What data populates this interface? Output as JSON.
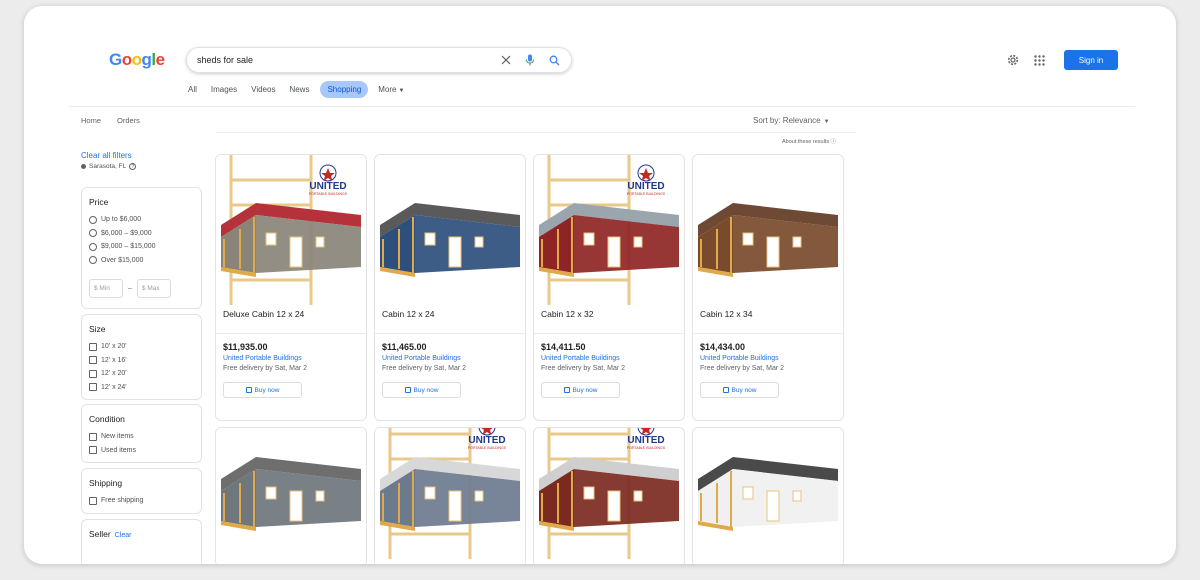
{
  "header": {
    "logo": [
      "G",
      "o",
      "o",
      "g",
      "l",
      "e"
    ],
    "logo_colors": [
      "#4285f4",
      "#ea4335",
      "#fbbc05",
      "#4285f4",
      "#34a853",
      "#ea4335"
    ],
    "search_value": "sheds for sale",
    "signin_label": "Sign in"
  },
  "tabs": [
    {
      "label": "All"
    },
    {
      "label": "Images"
    },
    {
      "label": "Videos"
    },
    {
      "label": "News"
    },
    {
      "label": "Shopping",
      "active": true
    },
    {
      "label": "More"
    }
  ],
  "subnav": {
    "home": "Home",
    "orders": "Orders",
    "sort": "Sort by: Relevance",
    "about": "About these results"
  },
  "sidebar": {
    "clear_all": "Clear all filters",
    "location": "Sarasota, FL",
    "price": {
      "title": "Price",
      "options": [
        "Up to $6,000",
        "$6,000 – $9,000",
        "$9,000 – $15,000",
        "Over $15,000"
      ],
      "min_placeholder": "$ Min",
      "max_placeholder": "$ Max",
      "dash": "–"
    },
    "size": {
      "title": "Size",
      "options": [
        "10' x 20'",
        "12' x 16'",
        "12' x 20'",
        "12' x 24'"
      ]
    },
    "condition": {
      "title": "Condition",
      "options": [
        "New items",
        "Used items"
      ]
    },
    "shipping": {
      "title": "Shipping",
      "options": [
        "Free shipping"
      ]
    },
    "seller": {
      "title": "Seller",
      "clear": "Clear"
    }
  },
  "products": [
    {
      "title": "Deluxe Cabin 12 x 24",
      "price": "$11,935.00",
      "seller": "United Portable Buildings",
      "delivery": "Free delivery by Sat, Mar 2",
      "buy": "Buy now",
      "wall": "#8a8478",
      "roof": "#b6323a"
    },
    {
      "title": "Cabin 12 x 24",
      "price": "$11,465.00",
      "seller": "United Portable Buildings",
      "delivery": "Free delivery by Sat, Mar 2",
      "buy": "Buy now",
      "wall": "#2e4f7c",
      "roof": "#5a5a5a"
    },
    {
      "title": "Cabin 12 x 32",
      "price": "$14,411.50",
      "seller": "United Portable Buildings",
      "delivery": "Free delivery by Sat, Mar 2",
      "buy": "Buy now",
      "wall": "#8f2424",
      "roof": "#9aa5ad"
    },
    {
      "title": "Cabin 12 x 34",
      "price": "$14,434.00",
      "seller": "United Portable Buildings",
      "delivery": "Free delivery by Sat, Mar 2",
      "buy": "Buy now",
      "wall": "#7a4a2c",
      "roof": "#6e4a34"
    }
  ],
  "products_row2": [
    {
      "wall": "#6f767c",
      "roof": "#6e6e6e"
    },
    {
      "wall": "#6c7a8e",
      "roof": "#d8d8d8"
    },
    {
      "wall": "#7b2a1f",
      "roof": "#cfcfcf"
    },
    {
      "wall": "#f0f0f0",
      "roof": "#4a4a4a"
    }
  ],
  "brand_badge": {
    "line1": "UNITED",
    "line2": "PORTABLE BUILDINGS"
  }
}
